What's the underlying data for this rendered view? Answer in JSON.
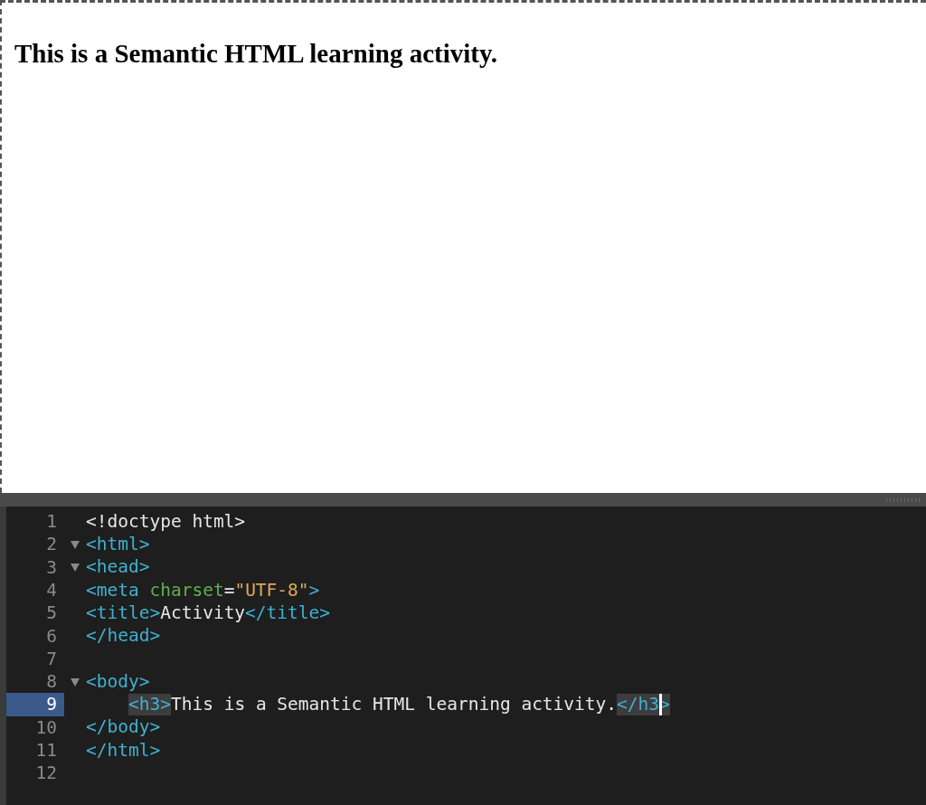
{
  "preview": {
    "heading": "This is a Semantic HTML learning activity."
  },
  "editor": {
    "lines": [
      {
        "number": "1",
        "current": false,
        "tokens": [
          {
            "kind": "text",
            "text": "<!doctype html>"
          }
        ]
      },
      {
        "number": "2",
        "expanded": true,
        "current": false,
        "tokens": [
          {
            "kind": "tag",
            "text": "<html>"
          }
        ]
      },
      {
        "number": "3",
        "expanded": true,
        "current": false,
        "tokens": [
          {
            "kind": "tag",
            "text": "<head>"
          }
        ]
      },
      {
        "number": "4",
        "current": false,
        "tokens": [
          {
            "kind": "tag",
            "text": "<meta "
          },
          {
            "kind": "attr",
            "text": "charset"
          },
          {
            "kind": "text",
            "text": "="
          },
          {
            "kind": "string",
            "text": "\"UTF-8\""
          },
          {
            "kind": "tag",
            "text": ">"
          }
        ]
      },
      {
        "number": "5",
        "current": false,
        "tokens": [
          {
            "kind": "tag",
            "text": "<title>"
          },
          {
            "kind": "text",
            "text": "Activity"
          },
          {
            "kind": "tag",
            "text": "</title>"
          }
        ]
      },
      {
        "number": "6",
        "current": false,
        "tokens": [
          {
            "kind": "tag",
            "text": "</head>"
          }
        ]
      },
      {
        "number": "7",
        "current": false
      },
      {
        "number": "8",
        "expanded": true,
        "current": false,
        "tokens": [
          {
            "kind": "tag",
            "text": "<body>"
          }
        ]
      },
      {
        "number": "9",
        "current": true,
        "indented": true,
        "tokens": [
          {
            "kind": "tag",
            "text": "<h3>",
            "matched": true
          },
          {
            "kind": "text",
            "text": "This is a Semantic HTML learning activity."
          },
          {
            "kind": "tag",
            "text": "</h3",
            "matched": true
          },
          {
            "kind": "tag",
            "text": ">",
            "matched": true,
            "cursor_before": true
          }
        ]
      },
      {
        "number": "10",
        "current": false,
        "tokens": [
          {
            "kind": "tag",
            "text": "</body>"
          }
        ]
      },
      {
        "number": "11",
        "current": false,
        "tokens": [
          {
            "kind": "tag",
            "text": "</html>"
          }
        ]
      },
      {
        "number": "12",
        "current": false
      }
    ]
  }
}
